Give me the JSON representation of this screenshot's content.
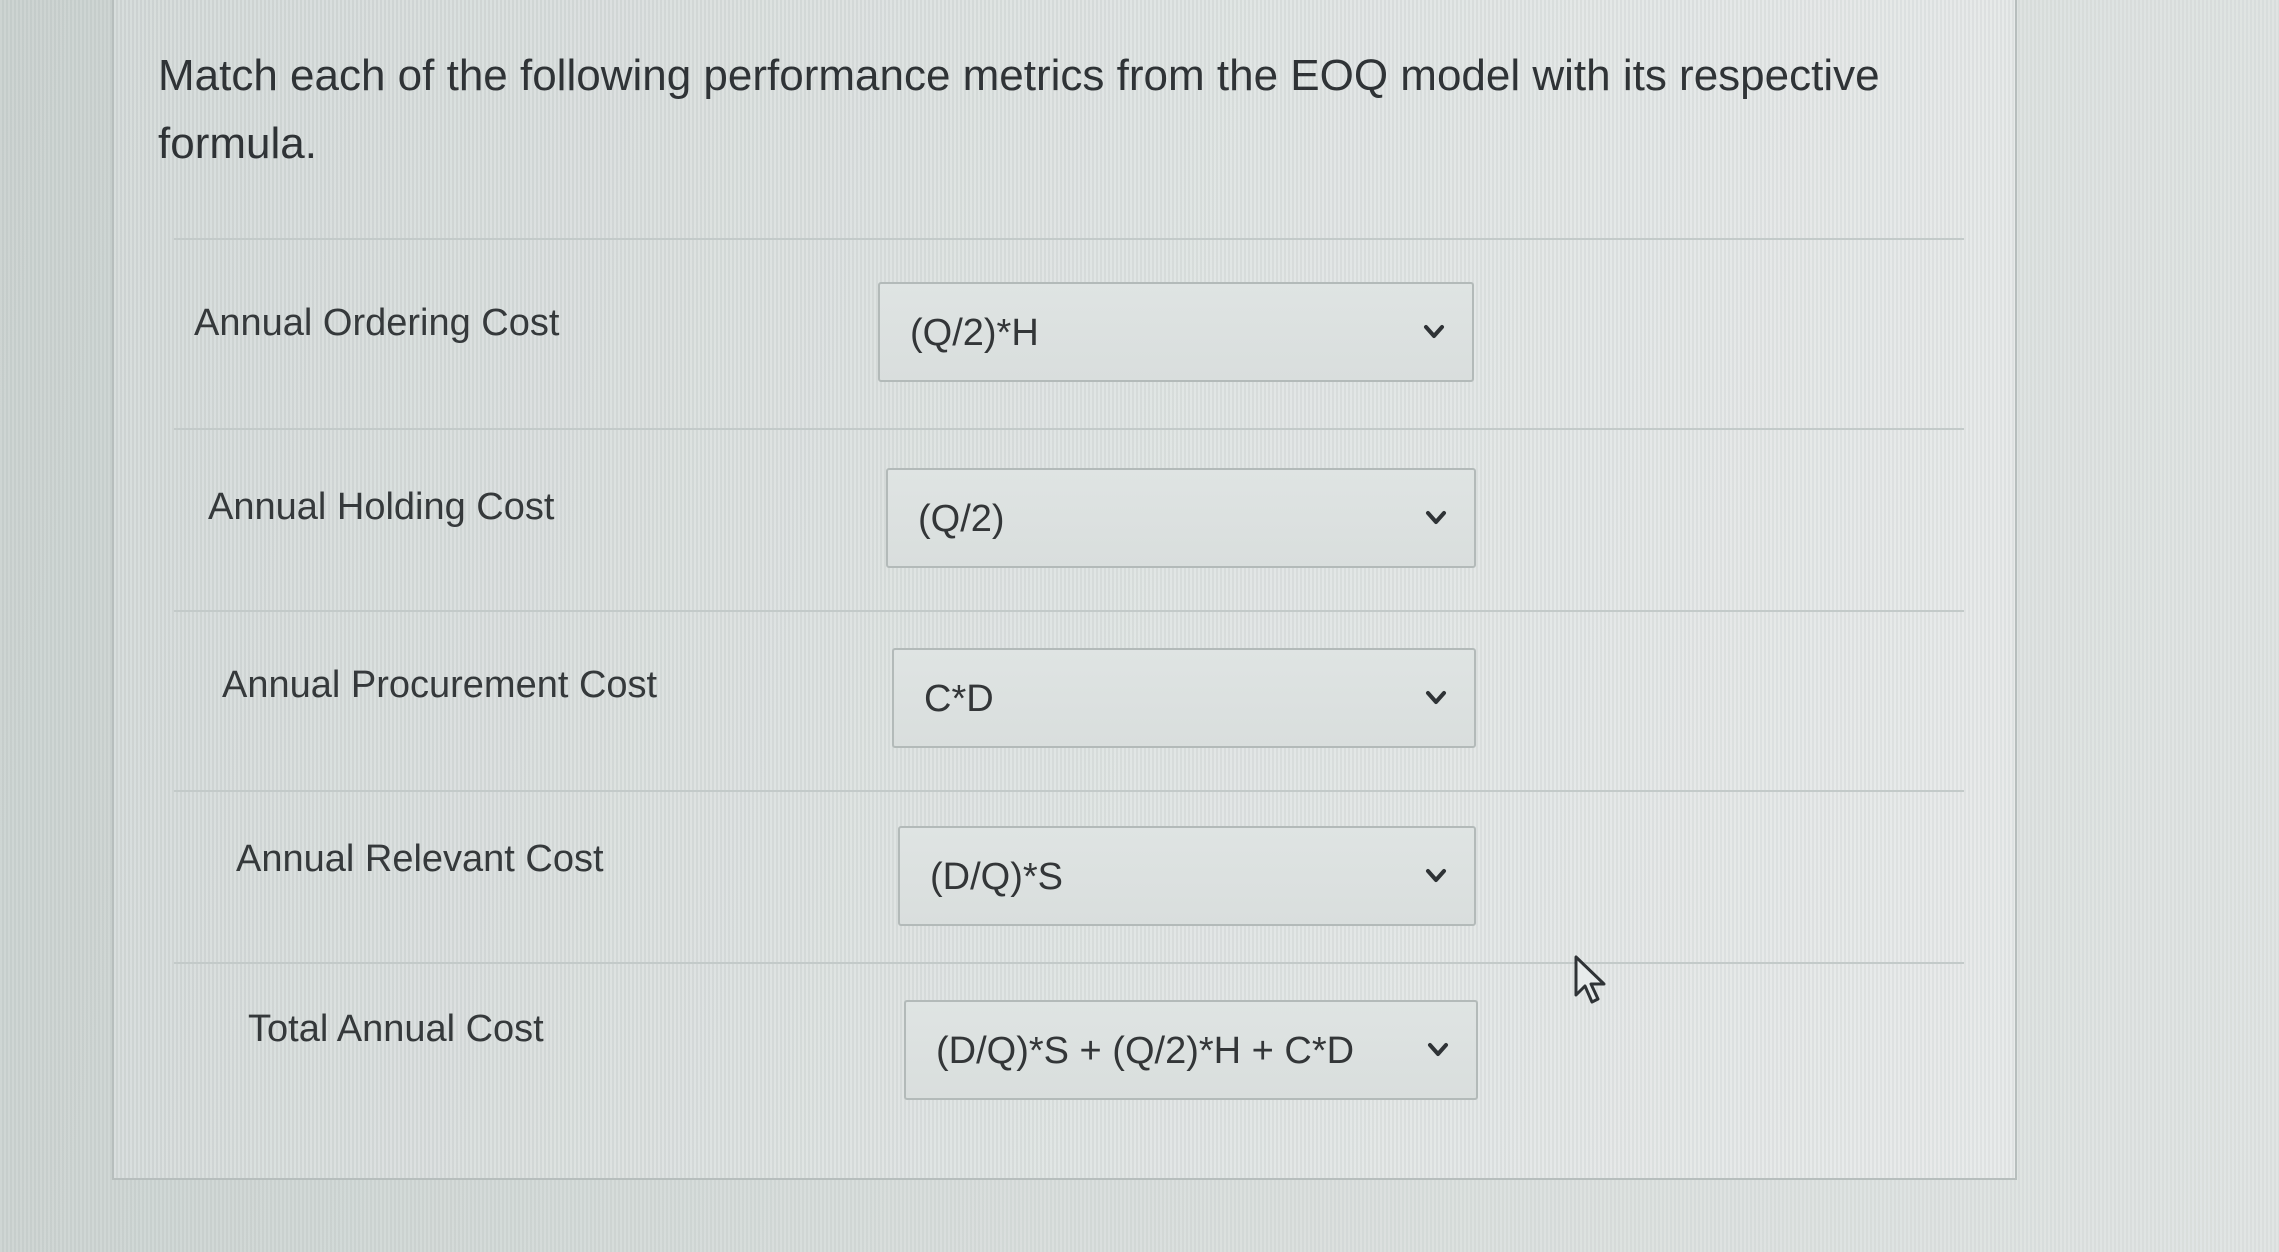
{
  "question": {
    "text": "Match each of the following performance metrics from the EOQ model with its respective formula."
  },
  "rows": [
    {
      "label": "Annual Ordering Cost",
      "selected": "(Q/2)*H"
    },
    {
      "label": "Annual Holding Cost",
      "selected": "(Q/2)"
    },
    {
      "label": "Annual Procurement Cost",
      "selected": "C*D"
    },
    {
      "label": "Annual Relevant Cost",
      "selected": "(D/Q)*S"
    },
    {
      "label": "Total Annual Cost",
      "selected": "(D/Q)*S + (Q/2)*H + C*D"
    }
  ],
  "icons": {
    "dropdown": "chevron-down-icon",
    "pointer": "mouse-cursor-icon"
  },
  "colors": {
    "text": "#2f3336",
    "border": "#b3bab9"
  }
}
